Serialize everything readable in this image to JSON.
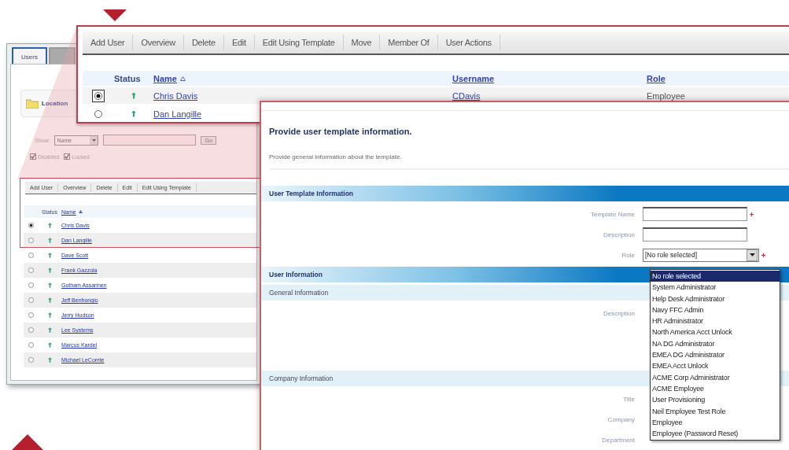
{
  "back_window": {
    "tabs": [
      {
        "label": "Users",
        "selected": true
      }
    ],
    "location": "Location",
    "filter": {
      "label": "Show:",
      "field": "Name",
      "button": "Go"
    },
    "checkboxes": [
      {
        "label": "Disabled",
        "checked": true
      },
      {
        "label": "Locked",
        "checked": true
      }
    ],
    "toolbar": [
      "Add User",
      "Overview",
      "Delete",
      "Edit",
      "Edit Using Template"
    ],
    "columns": [
      "Status",
      "Name"
    ],
    "rows": [
      {
        "name": "Chris Davis",
        "selected": true
      },
      {
        "name": "Dan Langille",
        "selected": false
      },
      {
        "name": "Dave Scott",
        "selected": false
      },
      {
        "name": "Frank Gazzola",
        "selected": false
      },
      {
        "name": "Gotham Assarinen",
        "selected": false
      },
      {
        "name": "Jeff Benhongio",
        "selected": false
      },
      {
        "name": "Jerry Hudson",
        "selected": false
      },
      {
        "name": "Lee Systems",
        "selected": false
      },
      {
        "name": "Marcus Kardel",
        "selected": false
      },
      {
        "name": "Michael LeComte",
        "selected": false
      }
    ]
  },
  "top_window": {
    "toolbar": [
      "Add User",
      "Overview",
      "Delete",
      "Edit",
      "Edit Using Template",
      "Move",
      "Member Of",
      "User Actions"
    ],
    "columns": [
      "Status",
      "Name",
      "Username",
      "Role"
    ],
    "rows": [
      {
        "name": "Chris Davis",
        "username": "CDavis",
        "role": "Employee",
        "selected": true
      },
      {
        "name": "Dan Langille",
        "selected": false
      }
    ]
  },
  "dialog": {
    "title": "Provide user template information.",
    "description": "Provide general information about the template.",
    "sections": [
      {
        "kind": "bar",
        "title": "User Template Information",
        "fields": [
          {
            "label": "Template Name",
            "kind": "text",
            "required": true
          },
          {
            "label": "Description",
            "kind": "text",
            "required": false
          },
          {
            "label": "Role",
            "kind": "select",
            "value": "[No role selected]",
            "required": true
          }
        ]
      },
      {
        "kind": "bar",
        "title": "User Information"
      },
      {
        "kind": "subbar",
        "title": "General Information",
        "fields": [
          {
            "label": "Description",
            "kind": "covered",
            "required": false
          }
        ]
      },
      {
        "kind": "subbar",
        "title": "Company Information",
        "fields": [
          {
            "label": "Title",
            "kind": "covered",
            "required": false
          },
          {
            "label": "Company",
            "kind": "covered",
            "required": false
          },
          {
            "label": "Department",
            "kind": "covered",
            "required": false
          }
        ]
      }
    ],
    "role_options": [
      {
        "label": "No role selected",
        "selected": true
      },
      {
        "label": "System Administrator",
        "selected": false
      },
      {
        "label": "Help Desk Administrator",
        "selected": false
      },
      {
        "label": "Navy FFC Admin",
        "selected": false
      },
      {
        "label": "HR Administrator",
        "selected": false
      },
      {
        "label": "North America Acct Unlock",
        "selected": false
      },
      {
        "label": "NA DG Administrator",
        "selected": false
      },
      {
        "label": "EMEA DG Administrator",
        "selected": false
      },
      {
        "label": "EMEA Acct Unlock",
        "selected": false
      },
      {
        "label": "ACME Corp Administrator",
        "selected": false
      },
      {
        "label": "ACME Employee",
        "selected": false
      },
      {
        "label": "User Provisioning",
        "selected": false
      },
      {
        "label": "Neil Employee Test Role",
        "selected": false
      },
      {
        "label": "Employee",
        "selected": false
      },
      {
        "label": "Employee (Password Reset)",
        "selected": false
      }
    ]
  }
}
